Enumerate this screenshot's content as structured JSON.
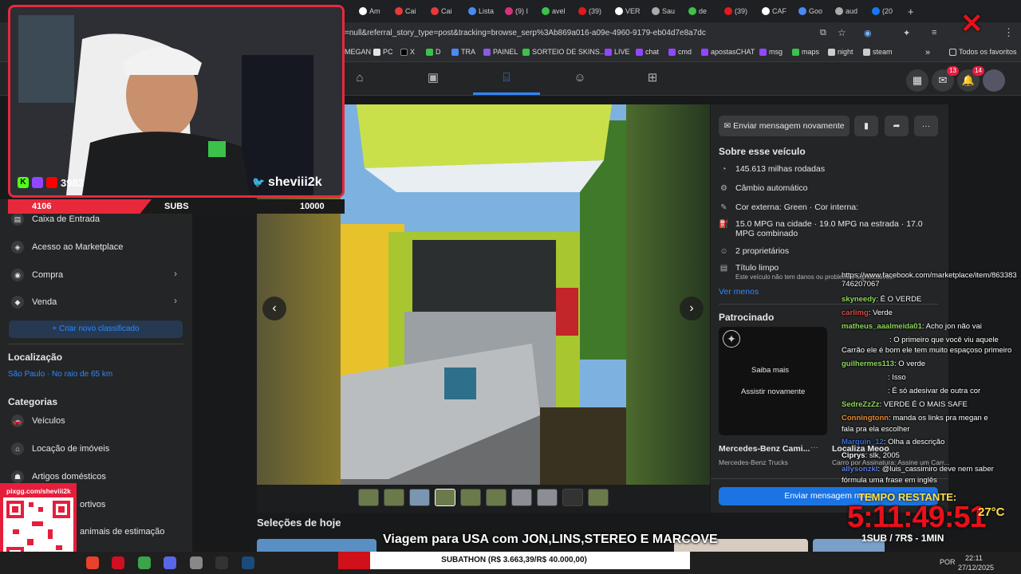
{
  "browser": {
    "tabs": [
      "Am",
      "Cai",
      "Cai",
      "Lista",
      "(9) I",
      "avel",
      "(39)",
      "VER",
      "Sau",
      "de",
      "(39)",
      "CAF",
      "Goo",
      "aud",
      "(20"
    ],
    "new_tab": "+",
    "url": "=null&referral_story_type=post&tracking=browse_serp%3Ab869a016-a09e-4960-9179-eb04d7e8a7dc",
    "bookmarks": [
      "MEGAN",
      "PC",
      "X",
      "D",
      "TRA",
      "PAINEL",
      "SORTEIO DE SKINS...",
      "LIVE",
      "chat",
      "cmd",
      "apostasCHAT",
      "msg",
      "maps",
      "night",
      "steam"
    ],
    "bookmarks_more": "»",
    "all_favorites": "Todos os favoritos"
  },
  "fbnav": {
    "messenger_badge": "13",
    "notif_badge": "14"
  },
  "stream": {
    "kick_viewers": "3983",
    "handle": "sheviii2k",
    "subs_current": "4106",
    "subs_label": "SUBS",
    "subs_goal": "10000"
  },
  "sidebar": {
    "items": [
      {
        "label": "Caixa de Entrada",
        "icon": "inbox-icon"
      },
      {
        "label": "Acesso ao Marketplace",
        "icon": "shield-icon"
      },
      {
        "label": "Compra",
        "icon": "bag-icon"
      },
      {
        "label": "Venda",
        "icon": "tag-icon"
      }
    ],
    "new_listing": "+ Criar novo classificado",
    "location_head": "Localização",
    "location_value": "São Paulo · No raio de 65 km",
    "categories_head": "Categorias",
    "categories": [
      "Veículos",
      "Locação de imóveis",
      "Artigos domésticos",
      "ortivos",
      "animais de estimação"
    ]
  },
  "listing": {
    "send_again": "Enviar mensagem novamente",
    "about_head": "Sobre esse veículo",
    "details": [
      "145.613 milhas rodadas",
      "Câmbio automático",
      "Cor externa: Green · Cor interna:",
      "15.0 MPG na cidade · 19.0 MPG na estrada · 17.0 MPG combinado",
      "2 proprietários",
      "Título limpo"
    ],
    "title_note": "Este veículo não tem danos ou problemas significativos.",
    "see_less": "Ver menos",
    "sponsored_head": "Patrocinado",
    "ad_more": "Saiba mais",
    "ad_replay": "Assistir novamente",
    "ad_title": "Mercedes-Benz Cami...",
    "ad_sub": "Mercedes-Benz Trucks",
    "ad2_title": "Localiza Meoo",
    "ad2_sub": "Carro por Assinatura: Assine um Carr...",
    "send_button": "Enviar mensagem nova",
    "today_head": "Seleções de hoje"
  },
  "chat": {
    "link": "https://www.facebook.com/marketplace/item/863383746207067",
    "messages": [
      {
        "user": "skyneedy",
        "text": ": É O VERDE",
        "color": "#8bd65a"
      },
      {
        "user": "carlimg",
        "text": ": Verde",
        "color": "#e04848"
      },
      {
        "user": "matheus_aaalmeida01",
        "text": ": Acho jon não vai",
        "color": "#8bd65a"
      },
      {
        "user": "",
        "text": ": O primeiro que você viu aquele",
        "color": "#3a6bd8"
      },
      {
        "user": "",
        "text": "Carrão ele é bom ele tem muito espaçoso primeiro",
        "color": "#ffffff"
      },
      {
        "user": "guilhermes113",
        "text": ": O verde",
        "color": "#8bd65a"
      },
      {
        "user": "",
        "text": ": Isso",
        "color": "#e04848"
      },
      {
        "user": "",
        "text": ": É só adesivar de outra cor",
        "color": "#e04848"
      },
      {
        "user": "SedreZzZz",
        "text": ": VERDE É O MAIS SAFE",
        "color": "#8bd65a"
      },
      {
        "user": "Conningtonn",
        "text": ": manda os links pra megan e",
        "color": "#e88a2a"
      },
      {
        "user": "",
        "text": "fala pra ela escolher",
        "color": "#ffffff"
      },
      {
        "user": "Marquin_12",
        "text": ": Olha a descrição",
        "color": "#3a6bd8"
      },
      {
        "user": "Ciprys",
        "text": ": slk, 2005",
        "color": "#ffffff"
      },
      {
        "user": "allysonzkl",
        "text": ": @luis_cassimiro deve nem saber",
        "color": "#5a7ae0"
      },
      {
        "user": "",
        "text": "fórmula uma frase em inglês",
        "color": "#ffffff"
      }
    ]
  },
  "timer": {
    "label": "TEMPO RESTANTE:",
    "value": "5:11:49:51",
    "rule": "1SUB / 7R$ - 1MIN",
    "temp": "27°C"
  },
  "caption": "Viagem para USA com JON,LINS,STEREO E MARCOVE",
  "subathon": {
    "text": "SUBATHON (R$ 3.663,39/R$ 40.000,00)",
    "progress": 0.0916
  },
  "qr": {
    "url": "pixgg.com/sheviii2k"
  },
  "taskbar": {
    "lang": "POR",
    "time": "22:11",
    "date": "27/12/2025"
  }
}
